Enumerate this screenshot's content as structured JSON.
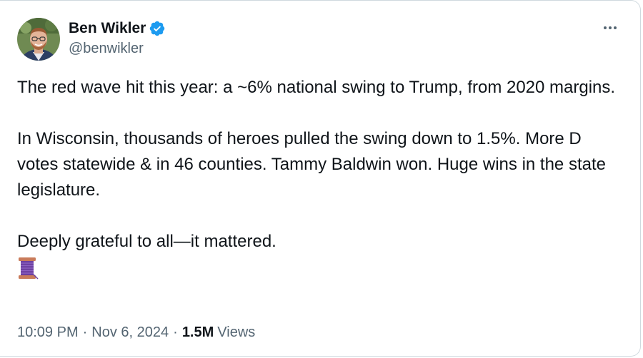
{
  "author": {
    "display_name": "Ben Wikler",
    "handle": "@benwikler",
    "verified": true,
    "avatar_icon": "profile-photo"
  },
  "tweet": {
    "paragraphs": [
      "The red wave hit this year: a ~6% national swing to Trump, from 2020 margins.",
      "In Wisconsin, thousands of heroes pulled the swing down to 1.5%. More D votes statewide & in 46 counties. Tammy Baldwin won. Huge wins in the state legislature.",
      "Deeply grateful to all—it mattered."
    ],
    "emoji": "spool-of-thread-emoji"
  },
  "meta": {
    "time": "10:09 PM",
    "date": "Nov 6, 2024",
    "separator": "·",
    "views_count": "1.5M",
    "views_label": "Views"
  },
  "colors": {
    "verified_blue": "#1d9bf0",
    "secondary_text": "#536471",
    "primary_text": "#0f1419"
  }
}
